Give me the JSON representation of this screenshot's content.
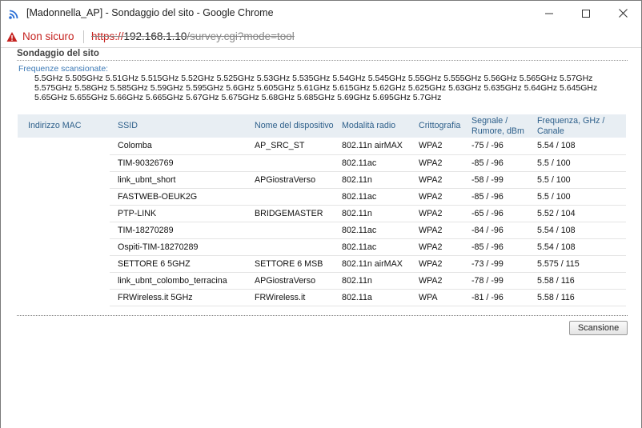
{
  "window": {
    "title": "[Madonnella_AP] - Sondaggio del sito - Google Chrome"
  },
  "addressbar": {
    "security_label": "Non sicuro",
    "url_scheme": "https://",
    "url_host": "192.168.1.10",
    "url_path": "/survey.cgi?mode=tool"
  },
  "page": {
    "title": "Sondaggio del sito",
    "frequencies_label": "Frequenze scansionate:",
    "frequencies": "5.5GHz 5.505GHz 5.51GHz 5.515GHz 5.52GHz 5.525GHz 5.53GHz 5.535GHz 5.54GHz 5.545GHz 5.55GHz 5.555GHz 5.56GHz 5.565GHz 5.57GHz 5.575GHz 5.58GHz 5.585GHz 5.59GHz 5.595GHz 5.6GHz 5.605GHz 5.61GHz 5.615GHz 5.62GHz 5.625GHz 5.63GHz 5.635GHz 5.64GHz 5.645GHz 5.65GHz 5.655GHz 5.66GHz 5.665GHz 5.67GHz 5.675GHz 5.68GHz 5.685GHz 5.69GHz 5.695GHz 5.7GHz",
    "scan_button": "Scansione"
  },
  "table": {
    "headers": {
      "mac": "Indirizzo MAC",
      "ssid": "SSID",
      "device": "Nome del dispositivo",
      "mode": "Modalità radio",
      "crypto": "Crittografia",
      "signal_line1": "Segnale /",
      "signal_line2": "Rumore, dBm",
      "freq_line1": "Frequenza, GHz /",
      "freq_line2": "Canale"
    },
    "rows": [
      {
        "mac": "",
        "ssid": "Colomba",
        "device": "AP_SRC_ST",
        "mode": "802.11n airMAX",
        "crypto": "WPA2",
        "signal": "-75 / -96",
        "freq": "5.54 / 108"
      },
      {
        "mac": "",
        "ssid": "TIM-90326769",
        "device": "",
        "mode": "802.11ac",
        "crypto": "WPA2",
        "signal": "-85 / -96",
        "freq": "5.5 / 100"
      },
      {
        "mac": "",
        "ssid": "link_ubnt_short",
        "device": "APGiostraVerso",
        "mode": "802.11n",
        "crypto": "WPA2",
        "signal": "-58 / -99",
        "freq": "5.5 / 100"
      },
      {
        "mac": "",
        "ssid": "FASTWEB-OEUK2G",
        "device": "",
        "mode": "802.11ac",
        "crypto": "WPA2",
        "signal": "-85 / -96",
        "freq": "5.5 / 100"
      },
      {
        "mac": "",
        "ssid": "PTP-LINK",
        "device": "BRIDGEMASTER",
        "mode": "802.11n",
        "crypto": "WPA2",
        "signal": "-65 / -96",
        "freq": "5.52 / 104"
      },
      {
        "mac": "",
        "ssid": "TIM-18270289",
        "device": "",
        "mode": "802.11ac",
        "crypto": "WPA2",
        "signal": "-84 / -96",
        "freq": "5.54 / 108"
      },
      {
        "mac": "",
        "ssid": "Ospiti-TIM-18270289",
        "device": "",
        "mode": "802.11ac",
        "crypto": "WPA2",
        "signal": "-85 / -96",
        "freq": "5.54 / 108"
      },
      {
        "mac": "",
        "ssid": "SETTORE 6 5GHZ",
        "device": "SETTORE 6 MSB",
        "mode": "802.11n airMAX",
        "crypto": "WPA2",
        "signal": "-73 / -99",
        "freq": "5.575 / 115"
      },
      {
        "mac": "",
        "ssid": "link_ubnt_colombo_terracina",
        "device": "APGiostraVerso",
        "mode": "802.11n",
        "crypto": "WPA2",
        "signal": "-78 / -99",
        "freq": "5.58 / 116"
      },
      {
        "mac": "",
        "ssid": "FRWireless.it 5GHz",
        "device": "FRWireless.it",
        "mode": "802.11a",
        "crypto": "WPA",
        "signal": "-81 / -96",
        "freq": "5.58 / 116"
      }
    ]
  },
  "colors": {
    "accent": "#3b78b5",
    "header_bg": "#e8eef3",
    "warning": "#c5221f"
  },
  "icons": {
    "app": "wifi-signal-icon",
    "warning": "warning-triangle-icon",
    "minimize": "minimize-icon",
    "maximize": "maximize-icon",
    "close": "close-icon"
  }
}
